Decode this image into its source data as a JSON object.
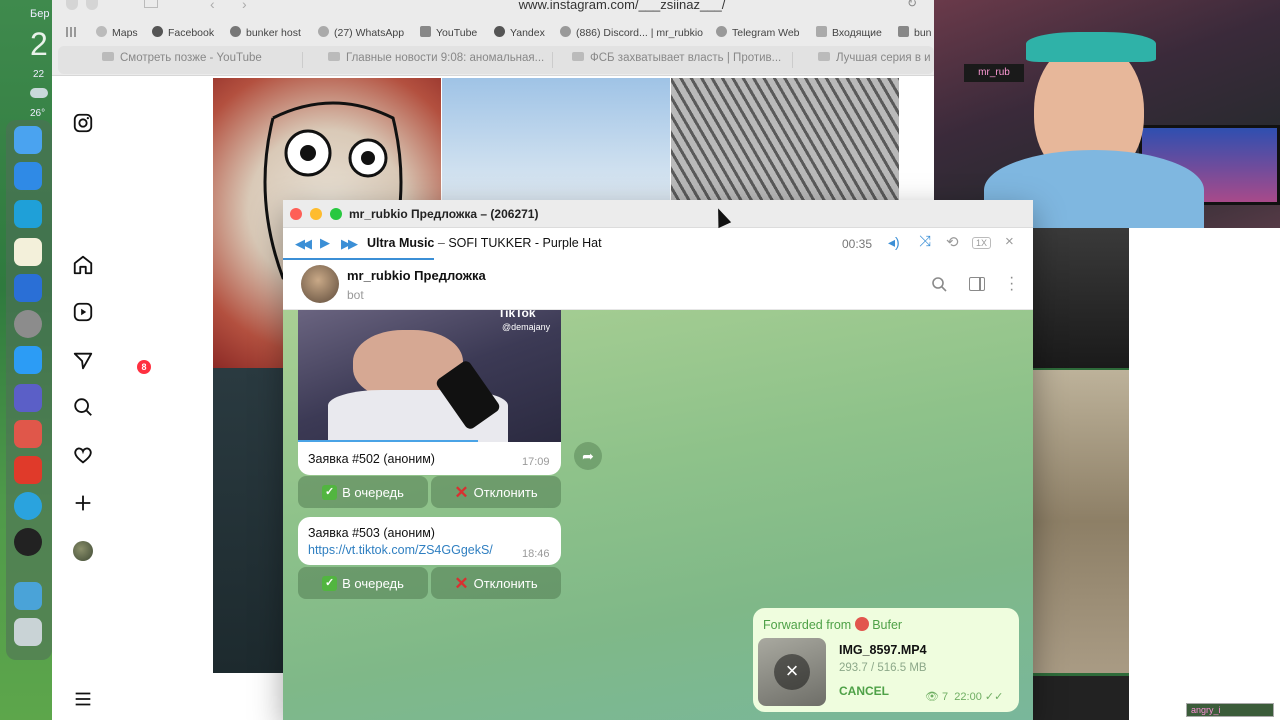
{
  "desktop": {
    "clock_hour": "2",
    "weekday_short": "Бер",
    "date_num": "22",
    "temp": "26°"
  },
  "browser": {
    "url": "www.instagram.com/___zsiinaz___/",
    "bookmarks": [
      "Maps",
      "Facebook",
      "bunker host",
      "(27) WhatsApp",
      "YouTube",
      "Yandex",
      "(886) Discord... | mr_rubkio",
      "Telegram Web",
      "Входящие",
      "bun"
    ],
    "tabs": [
      "Смотреть позже - YouTube",
      "Главные новости 9:08: аномальная...",
      "ФСБ захватывает власть | Против...",
      "Лучшая серия в и"
    ]
  },
  "instagram": {
    "notif_count": "8"
  },
  "telegram": {
    "window_title": "mr_rubkio Предложка – (206271)",
    "player": {
      "source": "Ultra Music",
      "track": "SOFI TUKKER - Purple Hat",
      "time": "00:35",
      "speed": "1X"
    },
    "chat": {
      "name": "mr_rubkio Предложка",
      "status": "bot"
    },
    "messages": [
      {
        "text": "Заявка #502 (аноним)",
        "time": "17:09",
        "video_handle": "@demajany",
        "video_brand": "TikTok"
      },
      {
        "text": "Заявка #503 (аноним)",
        "link": "https://vt.tiktok.com/ZS4GGgekS/",
        "time": "18:46"
      }
    ],
    "buttons": {
      "queue": "В очередь",
      "reject": "Отклонить"
    },
    "forwarded": {
      "label": "Forwarded from",
      "source": "Bufer",
      "file_name": "IMG_8597.MP4",
      "file_progress": "293.7 / 516.5 MB",
      "cancel": "CANCEL",
      "views": "7",
      "time": "22:00"
    }
  },
  "overlay": {
    "tag": "angry_i"
  }
}
